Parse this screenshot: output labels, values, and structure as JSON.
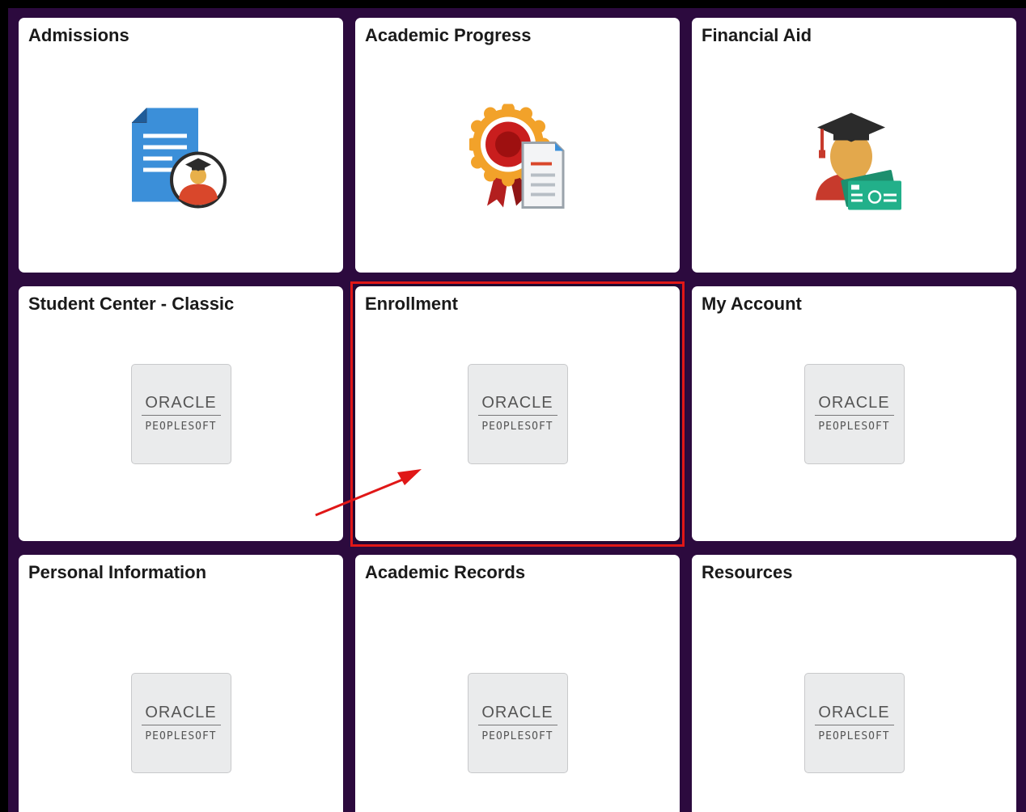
{
  "tiles": [
    {
      "id": "admissions",
      "title": "Admissions",
      "icon": "admissions-document-icon"
    },
    {
      "id": "academic-progress",
      "title": "Academic Progress",
      "icon": "award-ribbon-document-icon"
    },
    {
      "id": "financial-aid",
      "title": "Financial Aid",
      "icon": "graduate-money-icon"
    },
    {
      "id": "student-center-classic",
      "title": "Student Center - Classic",
      "icon": "oracle-peoplesoft-logo"
    },
    {
      "id": "enrollment",
      "title": "Enrollment",
      "icon": "oracle-peoplesoft-logo"
    },
    {
      "id": "my-account",
      "title": "My Account",
      "icon": "oracle-peoplesoft-logo"
    },
    {
      "id": "personal-information",
      "title": "Personal Information",
      "icon": "oracle-peoplesoft-logo"
    },
    {
      "id": "academic-records",
      "title": "Academic Records",
      "icon": "oracle-peoplesoft-logo"
    },
    {
      "id": "resources",
      "title": "Resources",
      "icon": "oracle-peoplesoft-logo"
    }
  ],
  "logo": {
    "brand": "ORACLE",
    "product": "PEOPLESOFT"
  },
  "annotation": {
    "highlighted_tile": "Enrollment",
    "highlight_color": "#e01717"
  },
  "colors": {
    "background": "#2c0a3e",
    "tile": "#ffffff",
    "title_text": "#1a1a1a"
  }
}
